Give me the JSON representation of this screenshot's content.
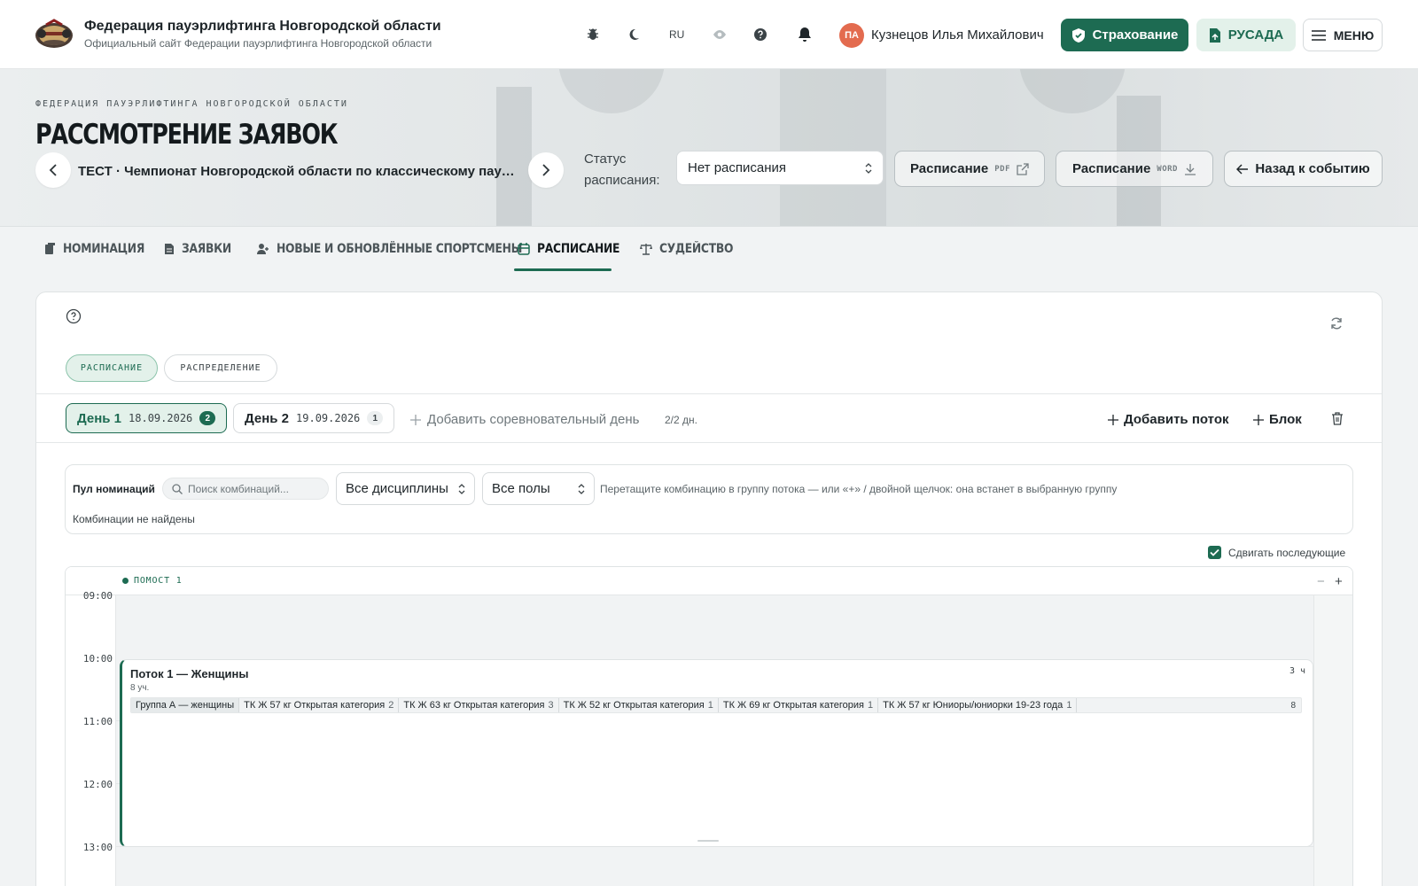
{
  "header": {
    "org_title": "Федерация пауэрлифтинга Новгородской области",
    "org_subtitle": "Официальный сайт Федерации пауэрлифтинга Новгородской области",
    "language": "RU",
    "user_initials": "ПА",
    "user_name": "Кузнецов Илья Михайлович",
    "insurance_label": "Страхование",
    "rusada_label": "РУСАДА",
    "menu_label": "МЕНЮ"
  },
  "hero": {
    "eyebrow": "ФЕДЕРАЦИЯ ПАУЭРЛИФТИНГА НОВГОРОДСКОЙ ОБЛАСТИ",
    "title": "РАССМОТРЕНИЕ ЗАЯВОК",
    "event_name": "ТЕСТ · Чемпионат Новгородской области по классическому пауэрлифтингу",
    "status_label": "Статус расписания:",
    "status_value": "Нет расписания",
    "pdf_btn_label": "Расписание",
    "pdf_tag": "PDF",
    "word_btn_label": "Расписание",
    "word_tag": "WORD",
    "back_label": "Назад к событию"
  },
  "tabs": [
    {
      "label": "НОМИНАЦИЯ",
      "active": false
    },
    {
      "label": "ЗАЯВКИ",
      "active": false
    },
    {
      "label": "НОВЫЕ И ОБНОВЛЁННЫЕ СПОРТСМЕНЫ",
      "active": false
    },
    {
      "label": "РАСПИСАНИЕ",
      "active": true
    },
    {
      "label": "СУДЕЙСТВО",
      "active": false
    }
  ],
  "panel": {
    "view_tabs": [
      {
        "label": "РАСПИСАНИЕ",
        "active": true
      },
      {
        "label": "РАСПРЕДЕЛЕНИЕ",
        "active": false
      }
    ],
    "days": [
      {
        "label": "День 1",
        "date": "18.09.2026",
        "count": "2",
        "active": true
      },
      {
        "label": "День 2",
        "date": "19.09.2026",
        "count": "1",
        "active": false
      }
    ],
    "add_day_label": "Добавить соревновательный день",
    "days_counter": "2/2 дн.",
    "add_flow_label": "Добавить поток",
    "block_label": "Блок"
  },
  "pool": {
    "label": "Пул номинаций",
    "search_placeholder": "Поиск комбинаций...",
    "discipline_value": "Все дисциплины",
    "gender_value": "Все полы",
    "hint": "Перетащите комбинацию в группу потока — или «+» / двойной щелчок: она встанет в выбранную группу",
    "empty_text": "Комбинации не найдены",
    "shift_label": "Сдвигать последующие",
    "shift_checked": true
  },
  "timeline": {
    "platform": "ПОМОСТ 1",
    "zoom_out": "−",
    "zoom_in": "+",
    "ticks": [
      "09:00",
      "10:00",
      "11:00",
      "12:00",
      "13:00"
    ],
    "flow": {
      "title": "Поток 1 — Женщины",
      "participants": "8 уч.",
      "duration": "3 ч",
      "group_name": "Группа А — женщины",
      "categories": [
        {
          "name": "ТК Ж 57 кг Открытая категория",
          "count": "2"
        },
        {
          "name": "ТК Ж 63 кг Открытая категория",
          "count": "3"
        },
        {
          "name": "ТК Ж 52 кг Открытая категория",
          "count": "1"
        },
        {
          "name": "ТК Ж 69 кг Открытая категория",
          "count": "1"
        },
        {
          "name": "ТК Ж 57 кг Юниоры/юниорки 19-23 года",
          "count": "1"
        }
      ],
      "group_total": "8"
    }
  },
  "colors": {
    "accent": "#1d6b52",
    "accent_light": "#e3f1ea",
    "avatar": "#e36b4f"
  }
}
